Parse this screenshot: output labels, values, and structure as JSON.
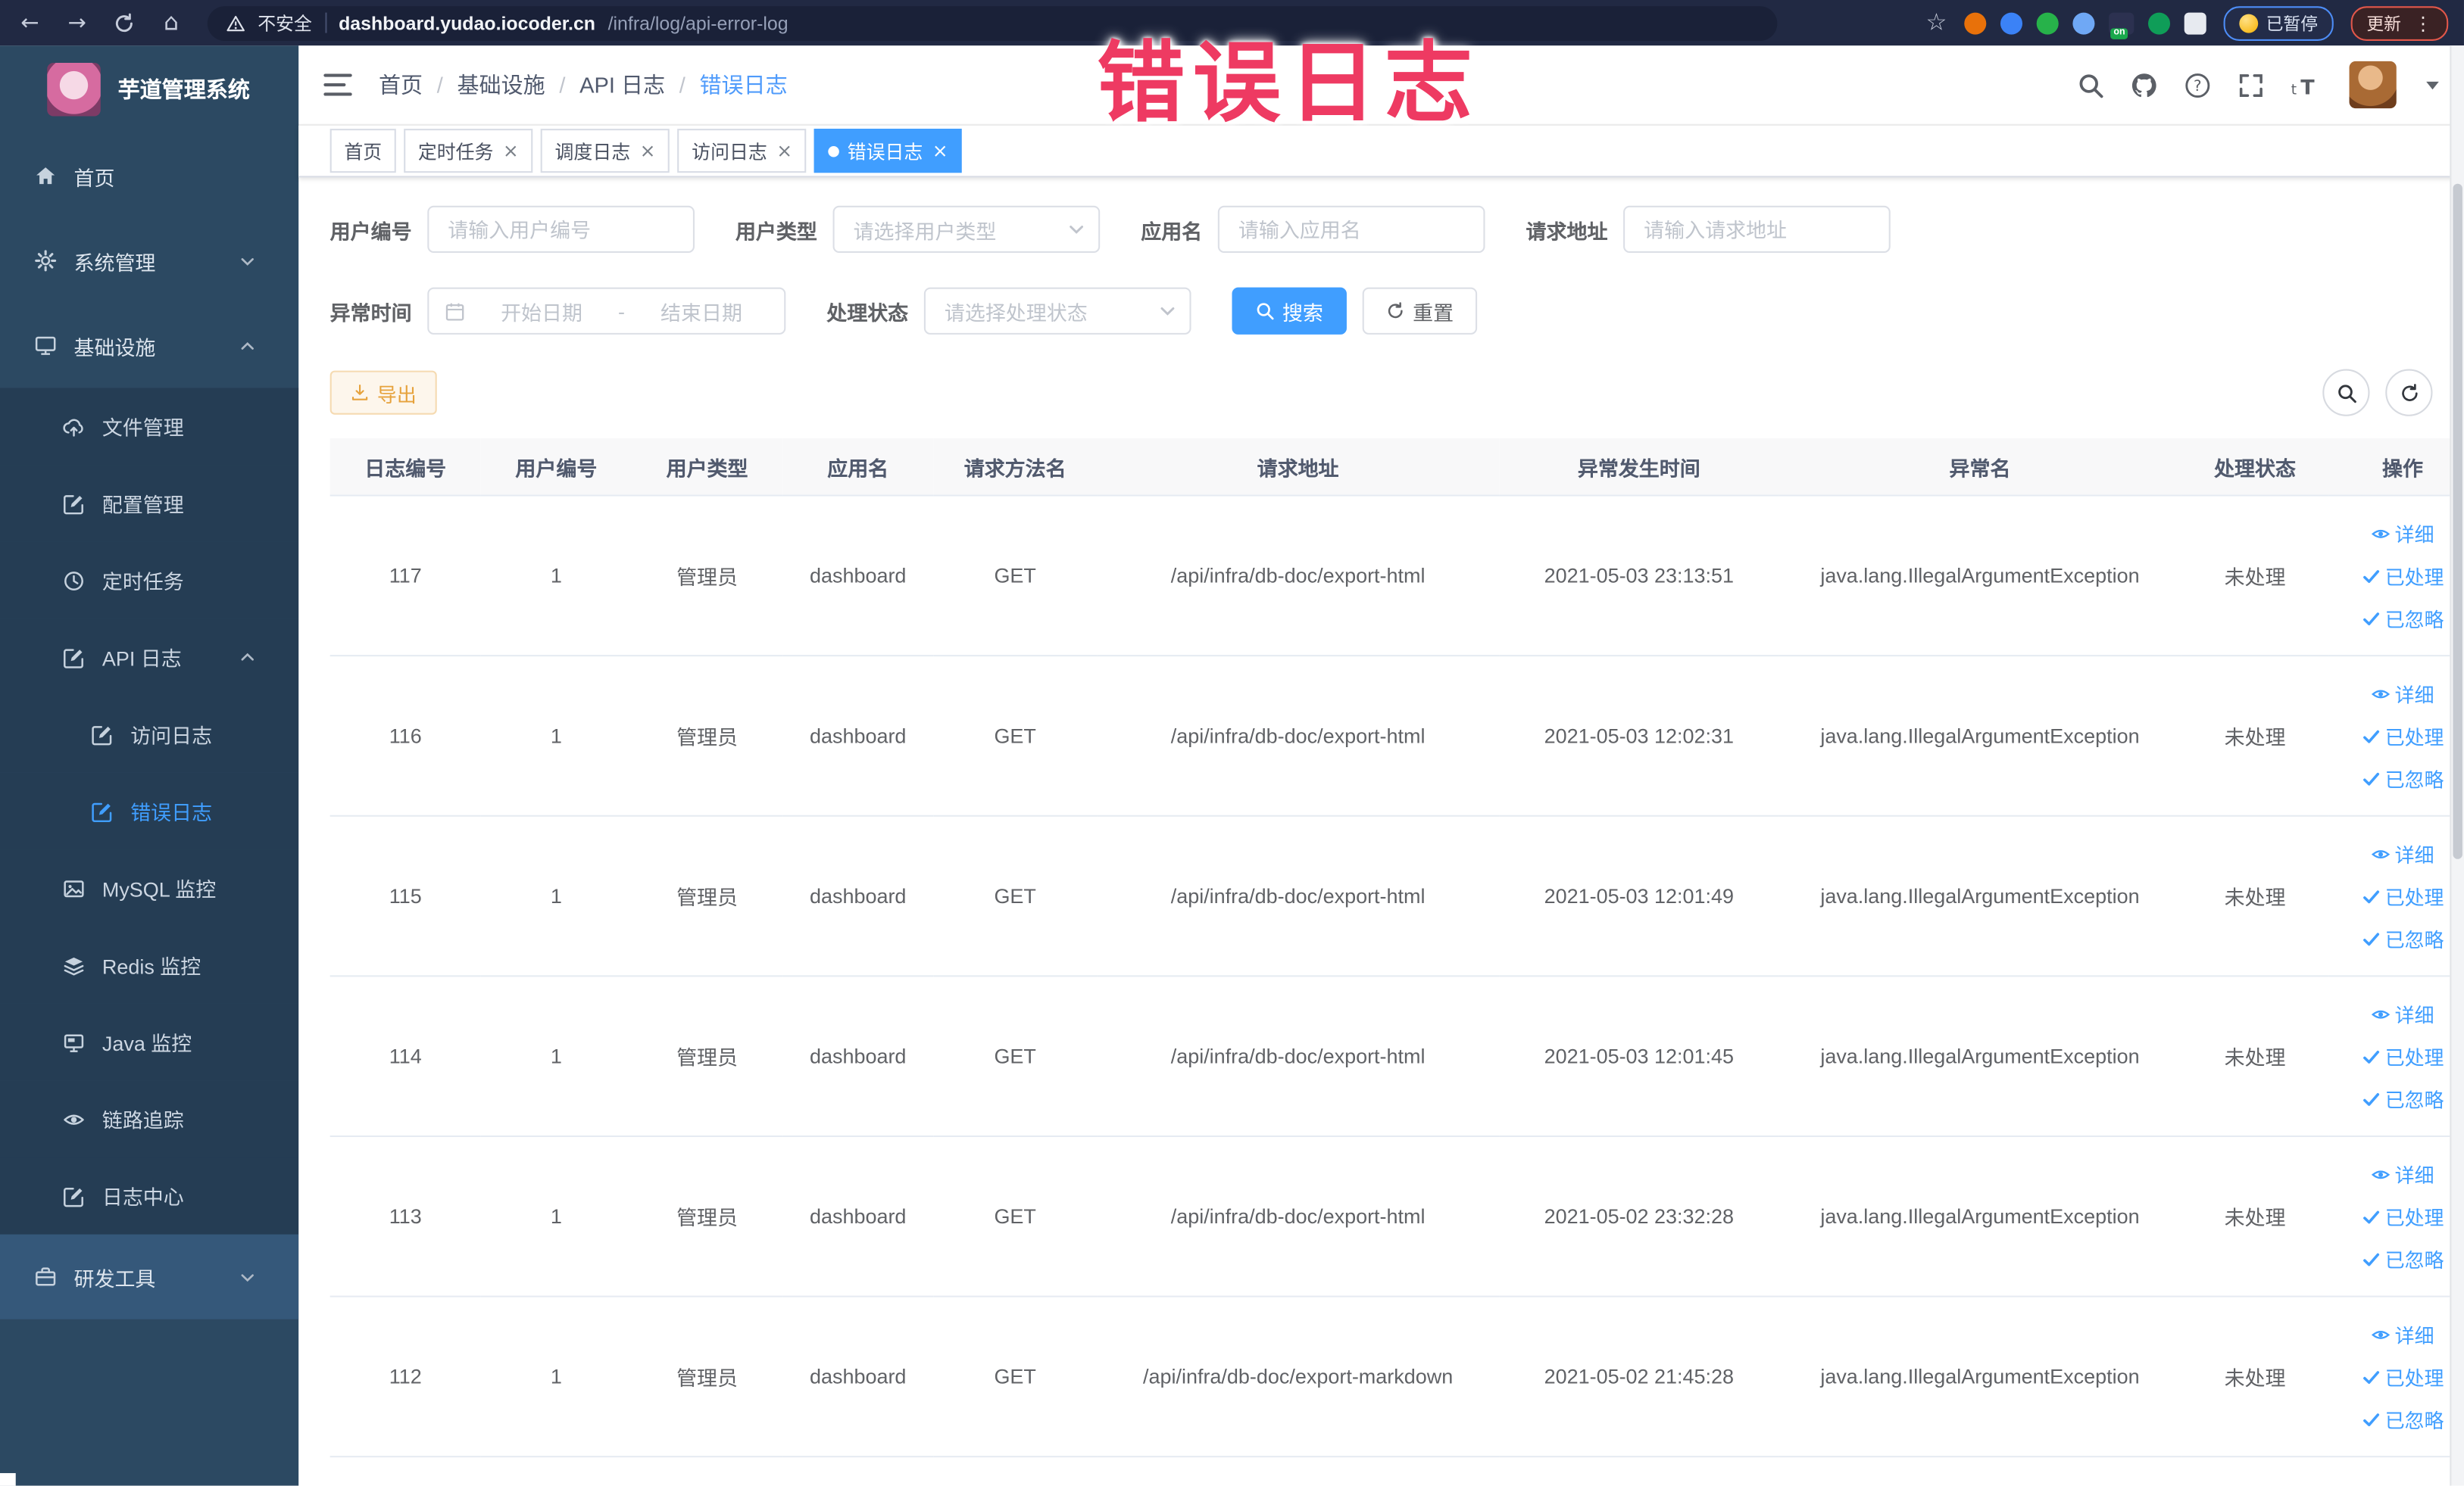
{
  "browser": {
    "insecure_label": "不安全",
    "url_host": "dashboard.yudao.iocoder.cn",
    "url_path": "/infra/log/api-error-log",
    "paused_badge": "已暂停",
    "update_button": "更新",
    "on_badge": "on",
    "extensions": [
      {
        "key": "orange-circle",
        "color": "#e8710a"
      },
      {
        "key": "blue-shield",
        "color": "#3b82f6"
      },
      {
        "key": "green-circle",
        "color": "#27b24a"
      },
      {
        "key": "blue-grid",
        "color": "#6fa8f5"
      },
      {
        "key": "on-badge",
        "color": "#19a84c"
      },
      {
        "key": "green-leaf",
        "color": "#0f9d58"
      },
      {
        "key": "white-puzzle",
        "color": "#e7eaf0"
      }
    ]
  },
  "overlay": {
    "title": "错误日志",
    "color": "#ee3a62"
  },
  "sidebar": {
    "app_title": "芋道管理系统",
    "items": [
      {
        "key": "home",
        "label": "首页",
        "icon": "home-icon",
        "level": 1
      },
      {
        "key": "system-management",
        "label": "系统管理",
        "icon": "gear-icon",
        "level": 1,
        "arrow": "down"
      },
      {
        "key": "infrastructure",
        "label": "基础设施",
        "icon": "monitor-icon",
        "level": 1,
        "arrow": "up"
      },
      {
        "key": "file-management",
        "label": "文件管理",
        "icon": "upload-cloud-icon",
        "level": 2
      },
      {
        "key": "config-management",
        "label": "配置管理",
        "icon": "config-edit-icon",
        "level": 2
      },
      {
        "key": "scheduled-tasks",
        "label": "定时任务",
        "icon": "clock-icon",
        "level": 2
      },
      {
        "key": "api-log",
        "label": "API 日志",
        "icon": "api-log-icon",
        "level": 2,
        "arrow": "up"
      },
      {
        "key": "access-log",
        "label": "访问日志",
        "icon": "access-log-icon",
        "level": 3
      },
      {
        "key": "error-log",
        "label": "错误日志",
        "icon": "error-log-icon",
        "level": 3,
        "active": true
      },
      {
        "key": "mysql-monitor",
        "label": "MySQL 监控",
        "icon": "mysql-monitor-icon",
        "level": 2
      },
      {
        "key": "redis-monitor",
        "label": "Redis 监控",
        "icon": "redis-monitor-icon",
        "level": 2
      },
      {
        "key": "java-monitor",
        "label": "Java 监控",
        "icon": "java-monitor-icon",
        "level": 2
      },
      {
        "key": "trace",
        "label": "链路追踪",
        "icon": "trace-eye-icon",
        "level": 2
      },
      {
        "key": "log-center",
        "label": "日志中心",
        "icon": "log-center-icon",
        "level": 2
      },
      {
        "key": "dev-tools",
        "label": "研发工具",
        "icon": "toolbox-icon",
        "level": 1,
        "arrow": "down",
        "tone": "light"
      }
    ]
  },
  "header": {
    "breadcrumb": [
      "首页",
      "基础设施",
      "API 日志",
      "错误日志"
    ]
  },
  "tabs": [
    {
      "key": "home",
      "label": "首页",
      "closable": false,
      "active": false
    },
    {
      "key": "scheduled-tasks",
      "label": "定时任务",
      "closable": true,
      "active": false
    },
    {
      "key": "schedule-log",
      "label": "调度日志",
      "closable": true,
      "active": false
    },
    {
      "key": "access-log",
      "label": "访问日志",
      "closable": true,
      "active": false
    },
    {
      "key": "error-log",
      "label": "错误日志",
      "closable": true,
      "active": true
    }
  ],
  "filters": {
    "user_id": {
      "label": "用户编号",
      "placeholder": "请输入用户编号"
    },
    "user_type": {
      "label": "用户类型",
      "placeholder": "请选择用户类型"
    },
    "app_name": {
      "label": "应用名",
      "placeholder": "请输入应用名"
    },
    "request_url": {
      "label": "请求地址",
      "placeholder": "请输入请求地址"
    },
    "exception_time": {
      "label": "异常时间",
      "start_placeholder": "开始日期",
      "separator": "-",
      "end_placeholder": "结束日期"
    },
    "process_status": {
      "label": "处理状态",
      "placeholder": "请选择处理状态"
    },
    "search_button": "搜索",
    "reset_button": "重置"
  },
  "toolbar": {
    "export_button": "导出"
  },
  "table": {
    "headers": [
      "日志编号",
      "用户编号",
      "用户类型",
      "应用名",
      "请求方法名",
      "请求地址",
      "异常发生时间",
      "异常名",
      "处理状态",
      "操作"
    ],
    "rows": [
      {
        "log_id": "117",
        "user_id": "1",
        "user_type": "管理员",
        "app_name": "dashboard",
        "method": "GET",
        "url": "/api/infra/db-doc/export-html",
        "time": "2021-05-03 23:13:51",
        "exception": "java.lang.IllegalArgumentException",
        "status": "未处理"
      },
      {
        "log_id": "116",
        "user_id": "1",
        "user_type": "管理员",
        "app_name": "dashboard",
        "method": "GET",
        "url": "/api/infra/db-doc/export-html",
        "time": "2021-05-03 12:02:31",
        "exception": "java.lang.IllegalArgumentException",
        "status": "未处理"
      },
      {
        "log_id": "115",
        "user_id": "1",
        "user_type": "管理员",
        "app_name": "dashboard",
        "method": "GET",
        "url": "/api/infra/db-doc/export-html",
        "time": "2021-05-03 12:01:49",
        "exception": "java.lang.IllegalArgumentException",
        "status": "未处理"
      },
      {
        "log_id": "114",
        "user_id": "1",
        "user_type": "管理员",
        "app_name": "dashboard",
        "method": "GET",
        "url": "/api/infra/db-doc/export-html",
        "time": "2021-05-03 12:01:45",
        "exception": "java.lang.IllegalArgumentException",
        "status": "未处理"
      },
      {
        "log_id": "113",
        "user_id": "1",
        "user_type": "管理员",
        "app_name": "dashboard",
        "method": "GET",
        "url": "/api/infra/db-doc/export-html",
        "time": "2021-05-02 23:32:28",
        "exception": "java.lang.IllegalArgumentException",
        "status": "未处理"
      },
      {
        "log_id": "112",
        "user_id": "1",
        "user_type": "管理员",
        "app_name": "dashboard",
        "method": "GET",
        "url": "/api/infra/db-doc/export-markdown",
        "time": "2021-05-02 21:45:28",
        "exception": "java.lang.IllegalArgumentException",
        "status": "未处理"
      }
    ],
    "row_actions": [
      {
        "key": "detail",
        "label": "详细",
        "icon": "detail-eye-icon"
      },
      {
        "key": "processed",
        "label": "已处理",
        "icon": "processed-check-icon"
      },
      {
        "key": "ignored",
        "label": "已忽略",
        "icon": "ignored-check-icon"
      }
    ]
  },
  "colors": {
    "primary": "#409eff",
    "warning": "#e6a23c",
    "sidebar": "#2c4962",
    "sidebar_submenu": "#253d54"
  }
}
